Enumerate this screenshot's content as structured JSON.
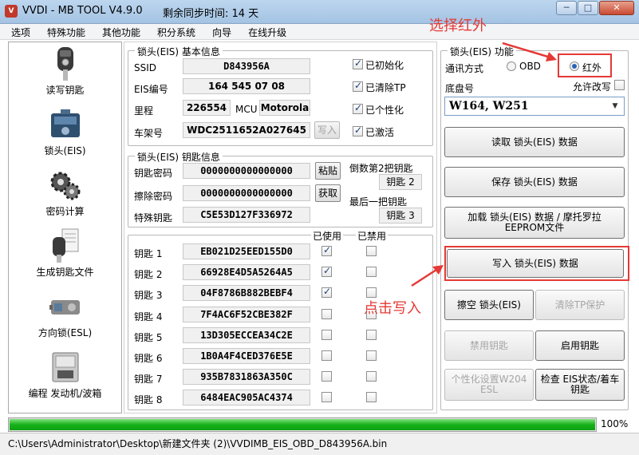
{
  "window": {
    "title": "VVDI - MB TOOL V4.9.0",
    "remaining": "剩余同步时间: 14 天",
    "minimize": "─",
    "maximize": "□",
    "close": "✕"
  },
  "menu": [
    "选项",
    "特殊功能",
    "其他功能",
    "积分系统",
    "向导",
    "在线升级"
  ],
  "sidebar": {
    "items": [
      {
        "label": "读写钥匙",
        "icon": "car-key-icon"
      },
      {
        "label": "锁头(EIS)",
        "icon": "eis-module-icon"
      },
      {
        "label": "密码计算",
        "icon": "gear-wheels-icon"
      },
      {
        "label": "生成钥匙文件",
        "icon": "key-file-icon"
      },
      {
        "label": "方向锁(ESL)",
        "icon": "steering-lock-icon"
      },
      {
        "label": "编程 发动机/波箱",
        "icon": "ecu-module-icon"
      }
    ]
  },
  "basic_info": {
    "title": "锁头(EIS) 基本信息",
    "ssid_label": "SSID",
    "ssid": "D843956A",
    "eis_no_label": "EIS编号",
    "eis_no": "164 545 07 08",
    "mileage_label": "里程",
    "mileage": "226554",
    "mcu_label": "MCU",
    "mcu": "Motorola",
    "vin_label": "车架号",
    "vin": "WDC2511652A027645",
    "write_btn": "写入",
    "checks": [
      {
        "label": "已初始化",
        "checked": true
      },
      {
        "label": "已清除TP",
        "checked": true
      },
      {
        "label": "已个性化",
        "checked": true
      },
      {
        "label": "已激活",
        "checked": true
      }
    ]
  },
  "key_info": {
    "title": "锁头(EIS) 钥匙信息",
    "key_pwd_label": "钥匙密码",
    "key_pwd": "0000000000000000",
    "paste_btn": "粘贴",
    "erase_pwd_label": "擦除密码",
    "erase_pwd": "0000000000000000",
    "get_btn": "获取",
    "special_key_label": "特殊钥匙",
    "special_key": "C5E53D127F336972",
    "second_last_label": "倒数第2把钥匙",
    "second_last": "钥匙 2",
    "last_label": "最后一把钥匙",
    "last": "钥匙 3"
  },
  "keys": {
    "used_label": "已使用",
    "disabled_label": "已禁用",
    "rows": [
      {
        "label": "钥匙 1",
        "value": "EB021D25EED155D0",
        "used": true,
        "disabled": false
      },
      {
        "label": "钥匙 2",
        "value": "66928E4D5A5264A5",
        "used": true,
        "disabled": false
      },
      {
        "label": "钥匙 3",
        "value": "04F8786B882BEBF4",
        "used": true,
        "disabled": false
      },
      {
        "label": "钥匙 4",
        "value": "7F4AC6F52CBE382F",
        "used": false,
        "disabled": false
      },
      {
        "label": "钥匙 5",
        "value": "13D305ECCEA34C2E",
        "used": false,
        "disabled": false
      },
      {
        "label": "钥匙 6",
        "value": "1B0A4F4CED376E5E",
        "used": false,
        "disabled": false
      },
      {
        "label": "钥匙 7",
        "value": "935B7831863A350C",
        "used": false,
        "disabled": false
      },
      {
        "label": "钥匙 8",
        "value": "6484EAC905AC4374",
        "used": false,
        "disabled": false
      }
    ]
  },
  "eis_func": {
    "title": "锁头(EIS) 功能",
    "comm_label": "通讯方式",
    "obd": "OBD",
    "ir": "红外",
    "chassis_label": "底盘号",
    "allow_modify": "允许改写",
    "chassis_value": "W164, W251",
    "read_btn": "读取 锁头(EIS) 数据",
    "save_btn": "保存 锁头(EIS) 数据",
    "load_btn": "加载 锁头(EIS) 数据 / 摩托罗拉EEPROM文件",
    "write_btn": "写入 锁头(EIS) 数据",
    "erase_btn": "擦空 锁头(EIS)",
    "clear_tp_btn": "清除TP保护",
    "disable_key_btn": "禁用钥匙",
    "enable_key_btn": "启用钥匙",
    "personalize_btn": "个性化设置W204 ESL",
    "check_btn": "检查 EIS状态/着车钥匙"
  },
  "progress": {
    "value": 100,
    "text": "100%"
  },
  "status": {
    "path": "C:\\Users\\Administrator\\Desktop\\新建文件夹 (2)\\VVDIMB_EIS_OBD_D843956A.bin"
  },
  "annotations": {
    "select_ir": "选择红外",
    "click_write": "点击写入",
    "accent": "#e53935"
  }
}
